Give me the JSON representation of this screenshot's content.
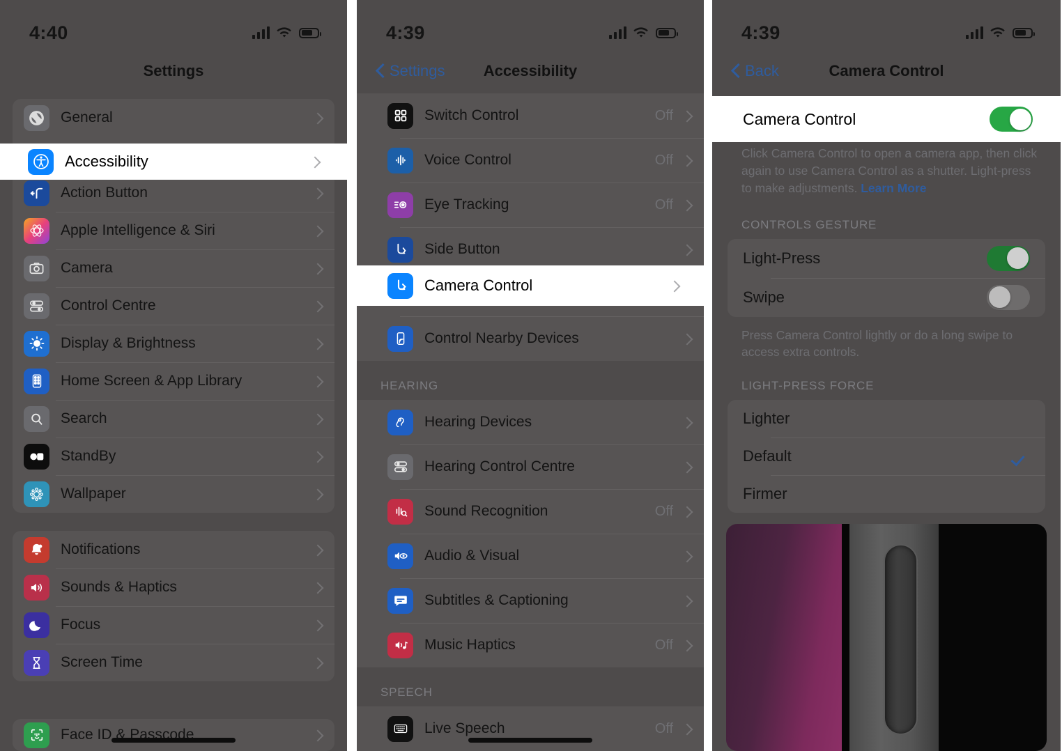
{
  "panels": [
    {
      "id": "settings",
      "status": {
        "time": "4:40",
        "signal": "cellular-bars-icon",
        "wifi": "wifi-icon",
        "battery": "battery-icon"
      },
      "nav": {
        "title": "Settings",
        "back_label": ""
      },
      "groups": [
        {
          "header": "",
          "rows": [
            {
              "label": "General",
              "icon": "gear-icon",
              "color": "#8a8a8e",
              "value": "",
              "highlight": false
            },
            {
              "label": "Accessibility",
              "icon": "accessibility-icon",
              "color": "#0a84ff",
              "value": "",
              "highlight": true
            },
            {
              "label": "Action Button",
              "icon": "action-button-icon",
              "color": "#1b4a9c",
              "value": "",
              "highlight": false
            },
            {
              "label": "Apple Intelligence & Siri",
              "icon": "siri-icon",
              "color": "#d94f8c",
              "value": "",
              "highlight": false
            },
            {
              "label": "Camera",
              "icon": "camera-icon",
              "color": "#6e6e73",
              "value": "",
              "highlight": false
            },
            {
              "label": "Control Centre",
              "icon": "control-centre-icon",
              "color": "#6e6e73",
              "value": "",
              "highlight": false
            },
            {
              "label": "Display & Brightness",
              "icon": "brightness-icon",
              "color": "#1f6fd0",
              "value": "",
              "highlight": false
            },
            {
              "label": "Home Screen & App Library",
              "icon": "home-screen-icon",
              "color": "#1f5fc4",
              "value": "",
              "highlight": false
            },
            {
              "label": "Search",
              "icon": "search-icon",
              "color": "#6e6e73",
              "value": "",
              "highlight": false
            },
            {
              "label": "StandBy",
              "icon": "standby-icon",
              "color": "#111111",
              "value": "",
              "highlight": false
            },
            {
              "label": "Wallpaper",
              "icon": "wallpaper-icon",
              "color": "#2f93b8",
              "value": "",
              "highlight": false
            }
          ]
        },
        {
          "header": "",
          "rows": [
            {
              "label": "Notifications",
              "icon": "notifications-icon",
              "color": "#c43b2e",
              "value": "",
              "highlight": false
            },
            {
              "label": "Sounds & Haptics",
              "icon": "sounds-icon",
              "color": "#b9304a",
              "value": "",
              "highlight": false
            },
            {
              "label": "Focus",
              "icon": "focus-icon",
              "color": "#3b2fa0",
              "value": "",
              "highlight": false
            },
            {
              "label": "Screen Time",
              "icon": "screen-time-icon",
              "color": "#4a3fb5",
              "value": "",
              "highlight": false
            }
          ]
        },
        {
          "header": "",
          "rows": [
            {
              "label": "Face ID & Passcode",
              "icon": "face-id-icon",
              "color": "#2e9e4f",
              "value": "",
              "highlight": false
            }
          ]
        }
      ]
    },
    {
      "id": "accessibility",
      "status": {
        "time": "4:39",
        "signal": "cellular-bars-icon",
        "wifi": "wifi-icon",
        "battery": "battery-icon"
      },
      "nav": {
        "title": "Accessibility",
        "back_label": "Settings"
      },
      "groups": [
        {
          "header": "",
          "rows": [
            {
              "label": "Switch Control",
              "icon": "switch-control-icon",
              "color": "#111111",
              "value": "Off",
              "highlight": false
            },
            {
              "label": "Voice Control",
              "icon": "voice-control-icon",
              "color": "#1c5fa8",
              "value": "Off",
              "highlight": false
            },
            {
              "label": "Eye Tracking",
              "icon": "eye-tracking-icon",
              "color": "#8e3ea8",
              "value": "Off",
              "highlight": false
            },
            {
              "label": "Side Button",
              "icon": "side-button-icon",
              "color": "#1b4a9c",
              "value": "",
              "highlight": false
            },
            {
              "label": "Camera Control",
              "icon": "camera-control-icon",
              "color": "#0a84ff",
              "value": "",
              "highlight": true
            },
            {
              "label": "Control Nearby Devices",
              "icon": "control-nearby-devices-icon",
              "color": "#1f5fc4",
              "value": "",
              "highlight": false
            }
          ]
        },
        {
          "header": "HEARING",
          "rows": [
            {
              "label": "Hearing Devices",
              "icon": "hearing-devices-icon",
              "color": "#1f5fc4",
              "value": "",
              "highlight": false
            },
            {
              "label": "Hearing Control Centre",
              "icon": "hearing-control-centre-icon",
              "color": "#6e6e73",
              "value": "",
              "highlight": false
            },
            {
              "label": "Sound Recognition",
              "icon": "sound-recognition-icon",
              "color": "#c22e46",
              "value": "Off",
              "highlight": false
            },
            {
              "label": "Audio & Visual",
              "icon": "audio-visual-icon",
              "color": "#1f5fc4",
              "value": "",
              "highlight": false
            },
            {
              "label": "Subtitles & Captioning",
              "icon": "subtitles-icon",
              "color": "#1f5fc4",
              "value": "",
              "highlight": false
            },
            {
              "label": "Music Haptics",
              "icon": "music-haptics-icon",
              "color": "#c22e46",
              "value": "Off",
              "highlight": false
            }
          ]
        },
        {
          "header": "SPEECH",
          "rows": [
            {
              "label": "Live Speech",
              "icon": "live-speech-icon",
              "color": "#111111",
              "value": "Off",
              "highlight": false
            }
          ]
        }
      ]
    },
    {
      "id": "camera-control",
      "status": {
        "time": "4:39",
        "signal": "cellular-bars-icon",
        "wifi": "wifi-icon",
        "battery": "battery-icon"
      },
      "nav": {
        "title": "Camera Control",
        "back_label": "Back"
      },
      "main_toggle": {
        "label": "Camera Control",
        "state": "on",
        "highlight": true
      },
      "main_note": {
        "text": "Click Camera Control to open a camera app, then click again to use Camera Control as a shutter. Light-press to make adjustments. ",
        "link": "Learn More"
      },
      "gesture_section": {
        "header": "CONTROLS GESTURE",
        "rows": [
          {
            "label": "Light-Press",
            "state": "on"
          },
          {
            "label": "Swipe",
            "state": "off"
          }
        ],
        "note": "Press Camera Control lightly or do a long swipe to access extra controls."
      },
      "force_section": {
        "header": "LIGHT-PRESS FORCE",
        "rows": [
          {
            "label": "Lighter",
            "selected": false
          },
          {
            "label": "Default",
            "selected": true
          },
          {
            "label": "Firmer",
            "selected": false
          }
        ]
      },
      "hardware_image": "camera-control-hardware-photo"
    }
  ],
  "colors": {
    "accent_blue": "#0a84ff",
    "toggle_green": "#27a745",
    "dim_background": "#4e4b4b",
    "highlight_white": "#ffffff",
    "link_blue": "#2f5c9e"
  }
}
